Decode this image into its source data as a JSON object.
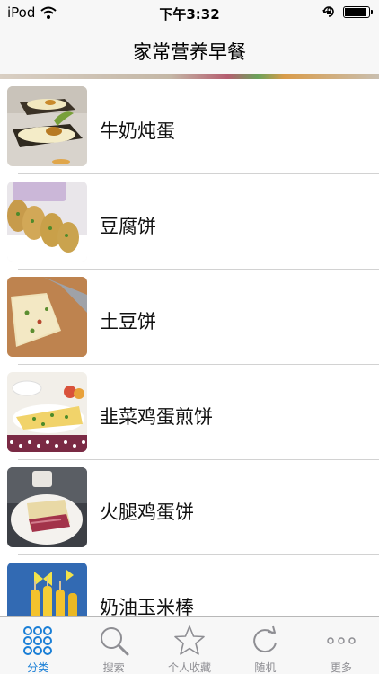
{
  "status_bar": {
    "carrier": "iPod",
    "time": "下午3:32",
    "battery_level": 0.92
  },
  "nav": {
    "title": "家常营养早餐"
  },
  "list": {
    "items": [
      {
        "label": "牛奶炖蛋",
        "thumbnail": "steamed-milk-egg-photo"
      },
      {
        "label": "豆腐饼",
        "thumbnail": "tofu-pancake-photo"
      },
      {
        "label": "土豆饼",
        "thumbnail": "potato-pancake-photo"
      },
      {
        "label": "韭菜鸡蛋煎饼",
        "thumbnail": "chive-egg-pancake-photo"
      },
      {
        "label": "火腿鸡蛋饼",
        "thumbnail": "ham-egg-pancake-photo"
      },
      {
        "label": "奶油玉米棒",
        "thumbnail": "buttered-corn-photo"
      }
    ]
  },
  "tab_bar": {
    "active_color": "#1a7fd6",
    "inactive_color": "#8e8e93",
    "tabs": [
      {
        "label": "分类",
        "icon": "grid-dots-icon",
        "active": true
      },
      {
        "label": "搜索",
        "icon": "magnifier-icon",
        "active": false
      },
      {
        "label": "个人收藏",
        "icon": "star-icon",
        "active": false
      },
      {
        "label": "随机",
        "icon": "refresh-icon",
        "active": false
      },
      {
        "label": "更多",
        "icon": "more-dots-icon",
        "active": false
      }
    ]
  }
}
